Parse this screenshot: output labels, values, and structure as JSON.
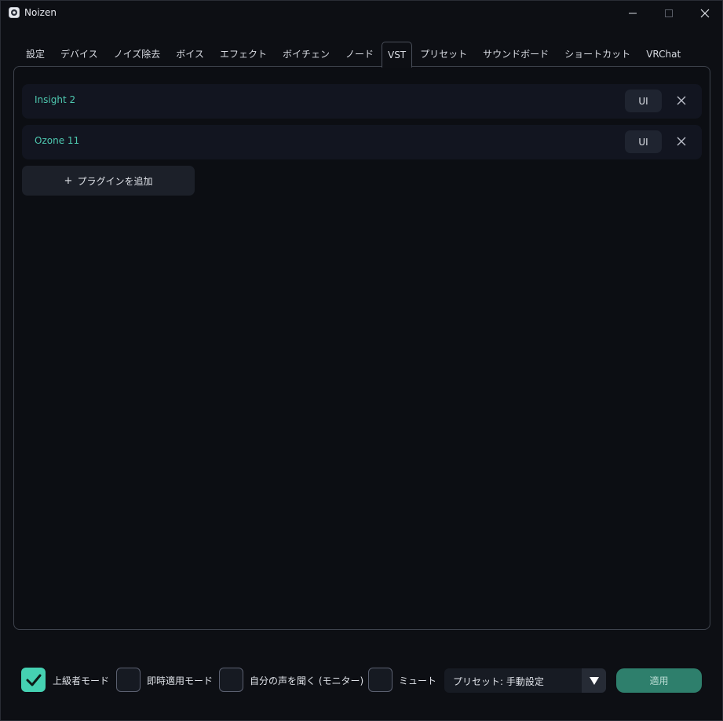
{
  "window": {
    "title": "Noizen",
    "controls": {
      "minimize": "minimize-icon",
      "maximize": "maximize-icon",
      "close": "close-icon"
    }
  },
  "tabs": [
    {
      "label": "設定",
      "active": false
    },
    {
      "label": "デバイス",
      "active": false
    },
    {
      "label": "ノイズ除去",
      "active": false
    },
    {
      "label": "ボイス",
      "active": false
    },
    {
      "label": "エフェクト",
      "active": false
    },
    {
      "label": "ボイチェン",
      "active": false
    },
    {
      "label": "ノード",
      "active": false
    },
    {
      "label": "VST",
      "active": true
    },
    {
      "label": "プリセット",
      "active": false
    },
    {
      "label": "サウンドボード",
      "active": false
    },
    {
      "label": "ショートカット",
      "active": false
    },
    {
      "label": "VRChat",
      "active": false
    }
  ],
  "plugins": [
    {
      "name": "Insight 2",
      "ui_label": "UI"
    },
    {
      "name": "Ozone 11",
      "ui_label": "UI"
    }
  ],
  "add_plugin": {
    "icon": "+",
    "label": "プラグインを追加"
  },
  "bottom": {
    "advanced_mode": {
      "label": "上級者モード",
      "checked": true
    },
    "instant_apply": {
      "label": "即時適用モード",
      "checked": false
    },
    "monitor": {
      "label": "自分の声を聞く (モニター)",
      "checked": false
    },
    "mute": {
      "label": "ミュート",
      "checked": false
    },
    "preset": {
      "value": "プリセット: 手動設定"
    },
    "apply_label": "適用"
  },
  "colors": {
    "accent": "#45d1b2",
    "plugin_name": "#4ec9b0",
    "apply_bg": "#2e7f6c",
    "background": "#0d0f14"
  }
}
